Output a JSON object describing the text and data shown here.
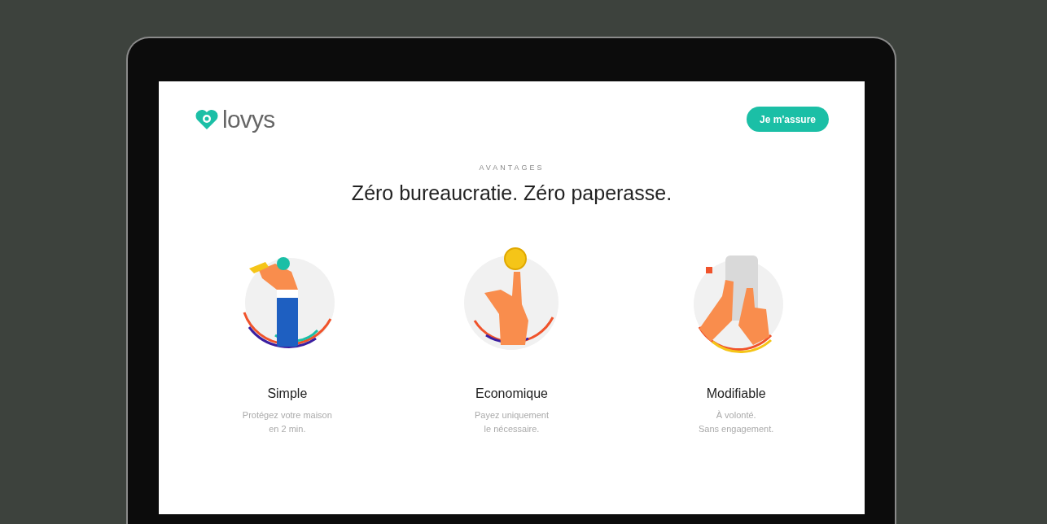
{
  "header": {
    "logo": "lovys",
    "cta": "Je m'assure"
  },
  "section": {
    "eyebrow": "AVANTAGES",
    "title": "Zéro bureaucratie. Zéro paperasse."
  },
  "features": [
    {
      "kind": "key",
      "title": "Simple",
      "lines": [
        "Protégez votre maison",
        "en 2 min."
      ]
    },
    {
      "kind": "coin",
      "title": "Economique",
      "lines": [
        "Payez uniquement",
        "le nécessaire."
      ]
    },
    {
      "kind": "phone",
      "title": "Modifiable",
      "lines": [
        "À volonté.",
        "Sans engagement."
      ]
    }
  ]
}
